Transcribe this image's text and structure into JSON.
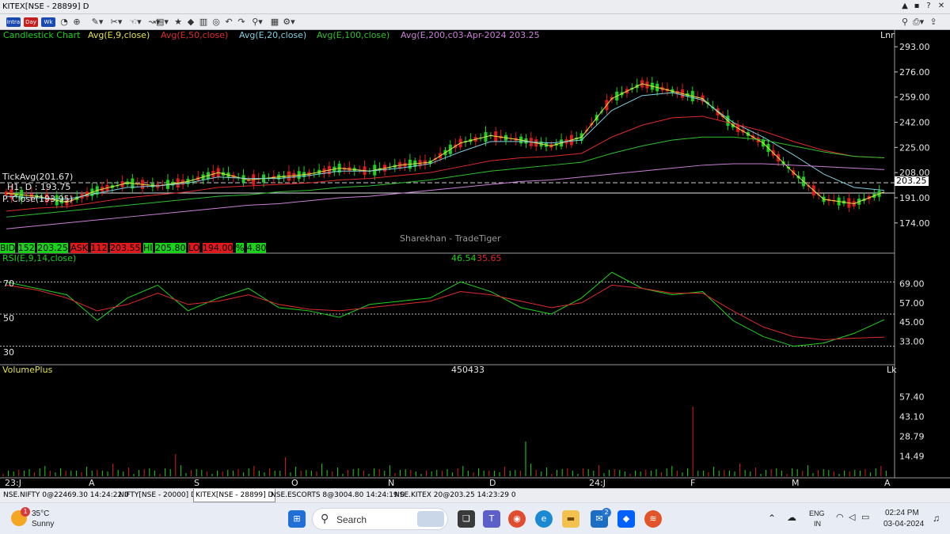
{
  "window": {
    "title": "KITEX[NSE - 28899] D",
    "controls": [
      "▲",
      "▪",
      "?",
      "✕"
    ]
  },
  "toolbar": {
    "intraday_label": "Intra",
    "daily_label": "Day",
    "weekly_label": "Wk"
  },
  "chart_header": {
    "chart_type": "Candlestick Chart",
    "ema9": "Avg(E,9,close)",
    "ema50": "Avg(E,50,close)",
    "ema20": "Avg(E,20,close)",
    "ema100": "Avg(E,100,close)",
    "ema200": "Avg(E,200,c03-Apr-2024 203.25",
    "scale_label": "Lnr"
  },
  "price_overlays": {
    "tick_avg": "TickAvg(201.67)",
    "h1_d": "H1- D : 193.75",
    "p_close": "P. Close(193.95)",
    "watermark": "Sharekhan - TradeTiger",
    "last_price": "203.25"
  },
  "quote_bar": {
    "bid_label": "BID",
    "bid_qty": "152",
    "bid_price": "203.25",
    "ask_label": "ASK",
    "ask_qty": "112",
    "ask_price": "203.55",
    "hi_label": "HI",
    "hi_value": "205.80",
    "lo_label": "LO",
    "lo_value": "194.00",
    "pct_label": "%",
    "pct_value": "4.80"
  },
  "rsi_panel": {
    "title": "RSI(E,9,14,close)",
    "value1": "46.54",
    "value2": "35.65",
    "left_levels": [
      "70",
      "50",
      "30"
    ]
  },
  "volume_panel": {
    "title": "VolumePlus",
    "value": "450433",
    "scale_label": "Lk"
  },
  "colors": {
    "bull": "#19d219",
    "bear": "#e01a1a",
    "ema9": "#e3e34a",
    "ema20": "#7fcfe0",
    "ema50": "#e02a2a",
    "ema100": "#2fbf2f",
    "ema200": "#c980d6",
    "rsi": "#1fd41f",
    "rsi_signal": "#e02a2a",
    "background": "#000000"
  },
  "tabs": [
    "NSE.NIFTY 0@22469.30 14:24:22 0",
    "NIFTY[NSE - 20000] D",
    "KITEX[NSE - 28899] D",
    "NSE.ESCORTS 8@3004.80 14:24:19 0",
    "NSE.KITEX 20@203.25 14:23:29 0"
  ],
  "taskbar": {
    "weather_temp": "35°C",
    "weather_desc": "Sunny",
    "weather_badge": "1",
    "search_placeholder": "Search",
    "mail_badge": "2",
    "lang_top": "ENG",
    "lang_bottom": "IN",
    "time": "02:24 PM",
    "date": "03-04-2024"
  },
  "chart_data": [
    {
      "type": "candlestick",
      "title": "Candlestick Chart",
      "symbol": "KITEX",
      "timeframe": "D",
      "x_tick_labels": [
        "23:J",
        "A",
        "S",
        "O",
        "N",
        "D",
        "24:J",
        "F",
        "M",
        "A"
      ],
      "y_tick_labels": [
        "293.00",
        "276.00",
        "259.00",
        "242.00",
        "225.00",
        "208.00",
        "191.00",
        "174.00"
      ],
      "ylim": [
        160,
        300
      ],
      "series": [
        {
          "name": "Avg(E,9,close)",
          "values": [
            194,
            192,
            188,
            196,
            201,
            199,
            202,
            208,
            203,
            205,
            207,
            211,
            209,
            213,
            215,
            228,
            233,
            230,
            226,
            232,
            258,
            268,
            263,
            258,
            240,
            228,
            208,
            190,
            187,
            195
          ]
        },
        {
          "name": "Avg(E,20,close)",
          "values": [
            192,
            191,
            190,
            194,
            198,
            199,
            201,
            205,
            204,
            204,
            206,
            209,
            209,
            211,
            214,
            222,
            229,
            229,
            228,
            230,
            250,
            260,
            262,
            257,
            242,
            232,
            220,
            207,
            198,
            196
          ]
        },
        {
          "name": "Avg(E,50,close)",
          "values": [
            182,
            184,
            185,
            188,
            191,
            193,
            195,
            198,
            199,
            200,
            201,
            203,
            204,
            206,
            208,
            212,
            216,
            218,
            219,
            221,
            232,
            240,
            245,
            246,
            241,
            236,
            229,
            223,
            219,
            218
          ]
        },
        {
          "name": "Avg(E,100,close)",
          "values": [
            178,
            180,
            182,
            184,
            186,
            188,
            190,
            192,
            193,
            195,
            196,
            198,
            199,
            201,
            203,
            206,
            209,
            211,
            213,
            215,
            221,
            226,
            230,
            232,
            232,
            230,
            226,
            222,
            219,
            218
          ]
        },
        {
          "name": "Avg(E,200,close)",
          "values": [
            170,
            172,
            174,
            176,
            178,
            180,
            182,
            184,
            186,
            187,
            189,
            191,
            192,
            194,
            196,
            198,
            200,
            202,
            203,
            205,
            207,
            209,
            211,
            213,
            214,
            214,
            213,
            212,
            211,
            210
          ]
        }
      ],
      "last_close": 203.25,
      "tick_avg": 201.67,
      "prev_close": 193.95,
      "h1_d": 193.75
    },
    {
      "type": "line",
      "title": "RSI(E,9,14,close)",
      "y_tick_labels": [
        "69.00",
        "57.00",
        "45.00",
        "33.00"
      ],
      "levels": [
        70,
        50,
        30
      ],
      "ylim": [
        20,
        80
      ],
      "series": [
        {
          "name": "RSI",
          "values": [
            70,
            66,
            62,
            46,
            60,
            68,
            52,
            60,
            66,
            54,
            52,
            48,
            56,
            58,
            60,
            70,
            64,
            54,
            50,
            60,
            76,
            66,
            62,
            64,
            46,
            36,
            30,
            32,
            38,
            46.54
          ]
        },
        {
          "name": "Signal",
          "values": [
            68,
            65,
            60,
            52,
            56,
            63,
            56,
            58,
            62,
            56,
            53,
            52,
            54,
            56,
            58,
            64,
            62,
            58,
            54,
            57,
            68,
            66,
            63,
            63,
            52,
            42,
            36,
            34,
            35,
            35.65
          ]
        }
      ]
    },
    {
      "type": "bar",
      "title": "VolumePlus",
      "y_tick_labels": [
        "57.40",
        "43.10",
        "28.79",
        "14.49"
      ],
      "ylim": [
        0,
        72
      ],
      "last_value": 450433
    }
  ]
}
